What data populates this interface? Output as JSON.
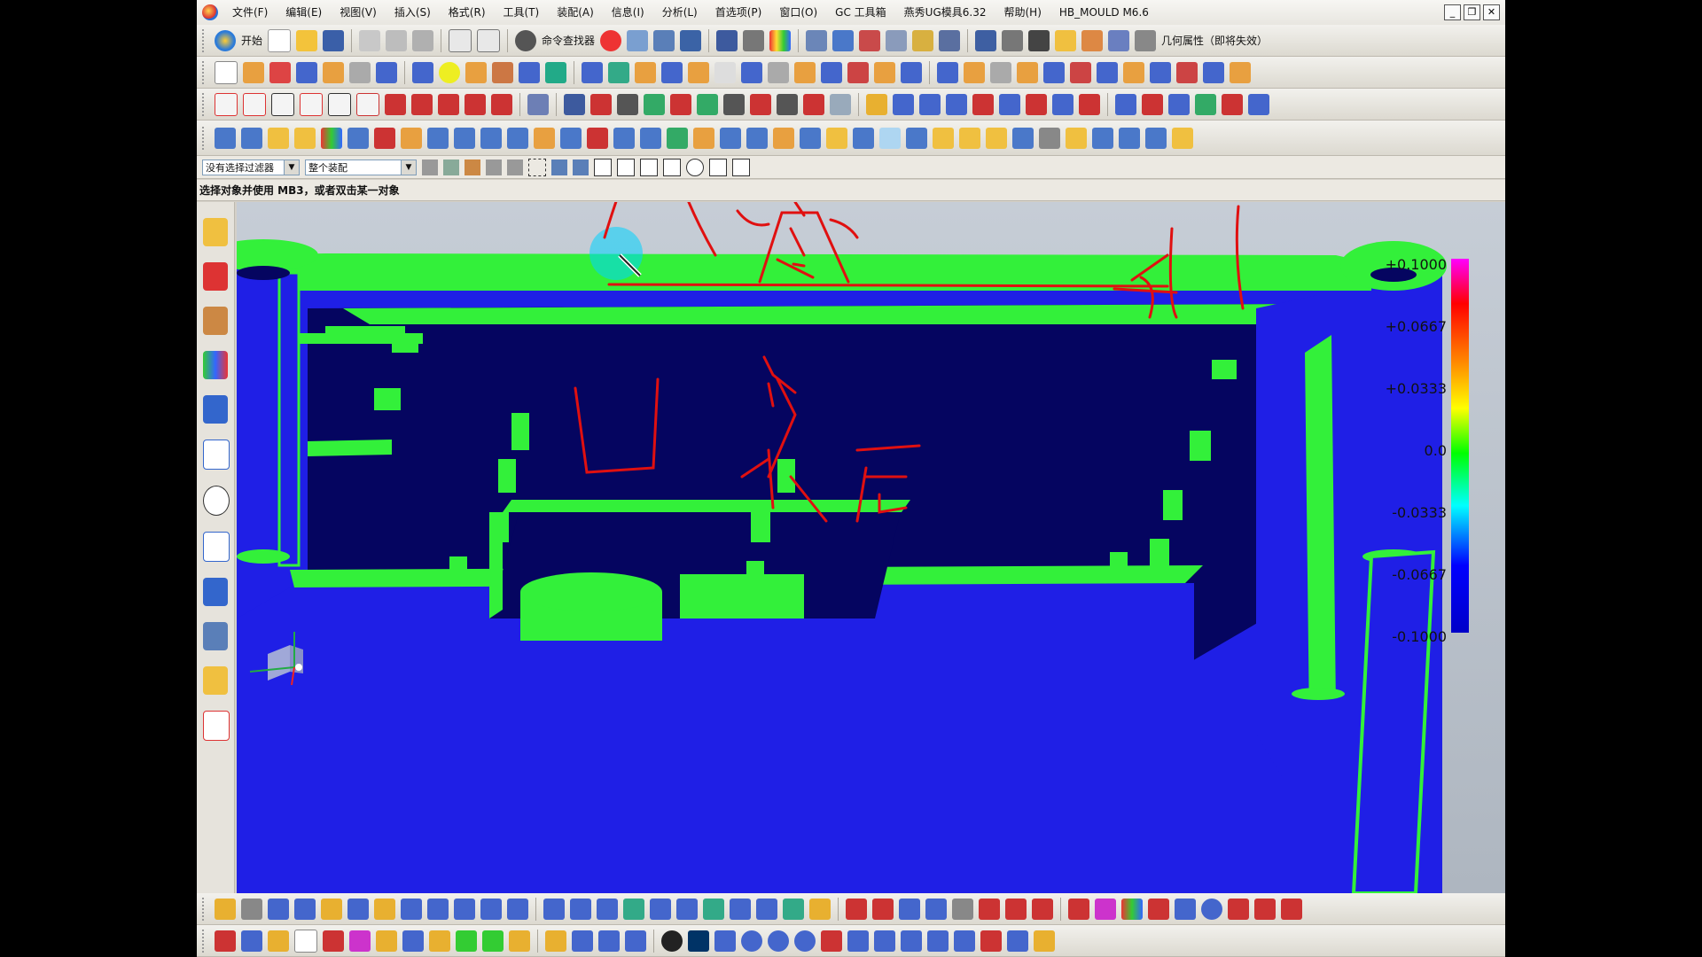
{
  "menubar": {
    "items": [
      "文件(F)",
      "编辑(E)",
      "视图(V)",
      "插入(S)",
      "格式(R)",
      "工具(T)",
      "装配(A)",
      "信息(I)",
      "分析(L)",
      "首选项(P)",
      "窗口(O)",
      "GC 工具箱",
      "燕秀UG模具6.32",
      "帮助(H)",
      "HB_MOULD M6.6"
    ]
  },
  "window_controls": {
    "minimize": "_",
    "restore": "❐",
    "close": "✕"
  },
  "toolbar": {
    "start_label": "开始",
    "command_finder_label": "命令查找器",
    "geometry_property_label": "几何属性（即将失效）"
  },
  "filters": {
    "type_filter": "没有选择过滤器",
    "scope_filter": "整个装配"
  },
  "status": {
    "prompt": "选择对象并使用 MB3，或者双击某一对象"
  },
  "color_scale": {
    "labels": [
      "+0.1000",
      "+0.0667",
      "+0.0333",
      "0.0",
      "-0.0333",
      "-0.0667",
      "-0.1000"
    ],
    "gradient": [
      "#ff00ff",
      "#ff0000",
      "#ff8c00",
      "#ffff00",
      "#00ff00",
      "#00ffff",
      "#0000ff",
      "#0000c8"
    ]
  },
  "model_colors": {
    "face_green": "#33f03a",
    "face_blue": "#1f1fe6",
    "deep_navy": "#050560",
    "annotation_red": "#e01010"
  },
  "icons": {
    "toolbar_row_1": [
      "new-file-icon",
      "open-folder-icon",
      "save-icon",
      "cut-icon",
      "copy-icon",
      "paste-icon",
      "undo-icon",
      "redo-icon",
      "command-finder-icon",
      "refresh-icon",
      "sketch-icon",
      "layout-icon",
      "cursor-icon",
      "snap-icon",
      "render-icon",
      "shade-icon",
      "view-icon",
      "orient-icon",
      "measure-icon",
      "geometry-icon"
    ],
    "sidebar": [
      "assembly-navigator-icon",
      "constraint-icon",
      "part-navigator-icon",
      "reuse-library-icon",
      "history-icon",
      "web-browser-icon",
      "clock-icon",
      "process-icon",
      "roles-icon",
      "hd3d-icon",
      "palette-icon",
      "system-icon"
    ]
  }
}
